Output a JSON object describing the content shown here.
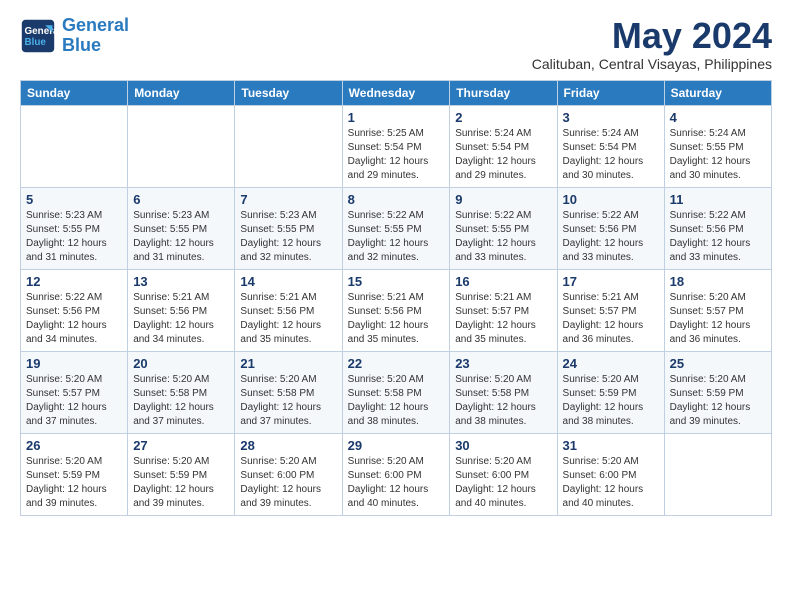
{
  "logo": {
    "line1": "General",
    "line2": "Blue"
  },
  "title": "May 2024",
  "subtitle": "Calituban, Central Visayas, Philippines",
  "weekdays": [
    "Sunday",
    "Monday",
    "Tuesday",
    "Wednesday",
    "Thursday",
    "Friday",
    "Saturday"
  ],
  "weeks": [
    [
      {
        "day": "",
        "info": ""
      },
      {
        "day": "",
        "info": ""
      },
      {
        "day": "",
        "info": ""
      },
      {
        "day": "1",
        "info": "Sunrise: 5:25 AM\nSunset: 5:54 PM\nDaylight: 12 hours\nand 29 minutes."
      },
      {
        "day": "2",
        "info": "Sunrise: 5:24 AM\nSunset: 5:54 PM\nDaylight: 12 hours\nand 29 minutes."
      },
      {
        "day": "3",
        "info": "Sunrise: 5:24 AM\nSunset: 5:54 PM\nDaylight: 12 hours\nand 30 minutes."
      },
      {
        "day": "4",
        "info": "Sunrise: 5:24 AM\nSunset: 5:55 PM\nDaylight: 12 hours\nand 30 minutes."
      }
    ],
    [
      {
        "day": "5",
        "info": "Sunrise: 5:23 AM\nSunset: 5:55 PM\nDaylight: 12 hours\nand 31 minutes."
      },
      {
        "day": "6",
        "info": "Sunrise: 5:23 AM\nSunset: 5:55 PM\nDaylight: 12 hours\nand 31 minutes."
      },
      {
        "day": "7",
        "info": "Sunrise: 5:23 AM\nSunset: 5:55 PM\nDaylight: 12 hours\nand 32 minutes."
      },
      {
        "day": "8",
        "info": "Sunrise: 5:22 AM\nSunset: 5:55 PM\nDaylight: 12 hours\nand 32 minutes."
      },
      {
        "day": "9",
        "info": "Sunrise: 5:22 AM\nSunset: 5:55 PM\nDaylight: 12 hours\nand 33 minutes."
      },
      {
        "day": "10",
        "info": "Sunrise: 5:22 AM\nSunset: 5:56 PM\nDaylight: 12 hours\nand 33 minutes."
      },
      {
        "day": "11",
        "info": "Sunrise: 5:22 AM\nSunset: 5:56 PM\nDaylight: 12 hours\nand 33 minutes."
      }
    ],
    [
      {
        "day": "12",
        "info": "Sunrise: 5:22 AM\nSunset: 5:56 PM\nDaylight: 12 hours\nand 34 minutes."
      },
      {
        "day": "13",
        "info": "Sunrise: 5:21 AM\nSunset: 5:56 PM\nDaylight: 12 hours\nand 34 minutes."
      },
      {
        "day": "14",
        "info": "Sunrise: 5:21 AM\nSunset: 5:56 PM\nDaylight: 12 hours\nand 35 minutes."
      },
      {
        "day": "15",
        "info": "Sunrise: 5:21 AM\nSunset: 5:56 PM\nDaylight: 12 hours\nand 35 minutes."
      },
      {
        "day": "16",
        "info": "Sunrise: 5:21 AM\nSunset: 5:57 PM\nDaylight: 12 hours\nand 35 minutes."
      },
      {
        "day": "17",
        "info": "Sunrise: 5:21 AM\nSunset: 5:57 PM\nDaylight: 12 hours\nand 36 minutes."
      },
      {
        "day": "18",
        "info": "Sunrise: 5:20 AM\nSunset: 5:57 PM\nDaylight: 12 hours\nand 36 minutes."
      }
    ],
    [
      {
        "day": "19",
        "info": "Sunrise: 5:20 AM\nSunset: 5:57 PM\nDaylight: 12 hours\nand 37 minutes."
      },
      {
        "day": "20",
        "info": "Sunrise: 5:20 AM\nSunset: 5:58 PM\nDaylight: 12 hours\nand 37 minutes."
      },
      {
        "day": "21",
        "info": "Sunrise: 5:20 AM\nSunset: 5:58 PM\nDaylight: 12 hours\nand 37 minutes."
      },
      {
        "day": "22",
        "info": "Sunrise: 5:20 AM\nSunset: 5:58 PM\nDaylight: 12 hours\nand 38 minutes."
      },
      {
        "day": "23",
        "info": "Sunrise: 5:20 AM\nSunset: 5:58 PM\nDaylight: 12 hours\nand 38 minutes."
      },
      {
        "day": "24",
        "info": "Sunrise: 5:20 AM\nSunset: 5:59 PM\nDaylight: 12 hours\nand 38 minutes."
      },
      {
        "day": "25",
        "info": "Sunrise: 5:20 AM\nSunset: 5:59 PM\nDaylight: 12 hours\nand 39 minutes."
      }
    ],
    [
      {
        "day": "26",
        "info": "Sunrise: 5:20 AM\nSunset: 5:59 PM\nDaylight: 12 hours\nand 39 minutes."
      },
      {
        "day": "27",
        "info": "Sunrise: 5:20 AM\nSunset: 5:59 PM\nDaylight: 12 hours\nand 39 minutes."
      },
      {
        "day": "28",
        "info": "Sunrise: 5:20 AM\nSunset: 6:00 PM\nDaylight: 12 hours\nand 39 minutes."
      },
      {
        "day": "29",
        "info": "Sunrise: 5:20 AM\nSunset: 6:00 PM\nDaylight: 12 hours\nand 40 minutes."
      },
      {
        "day": "30",
        "info": "Sunrise: 5:20 AM\nSunset: 6:00 PM\nDaylight: 12 hours\nand 40 minutes."
      },
      {
        "day": "31",
        "info": "Sunrise: 5:20 AM\nSunset: 6:00 PM\nDaylight: 12 hours\nand 40 minutes."
      },
      {
        "day": "",
        "info": ""
      }
    ]
  ]
}
